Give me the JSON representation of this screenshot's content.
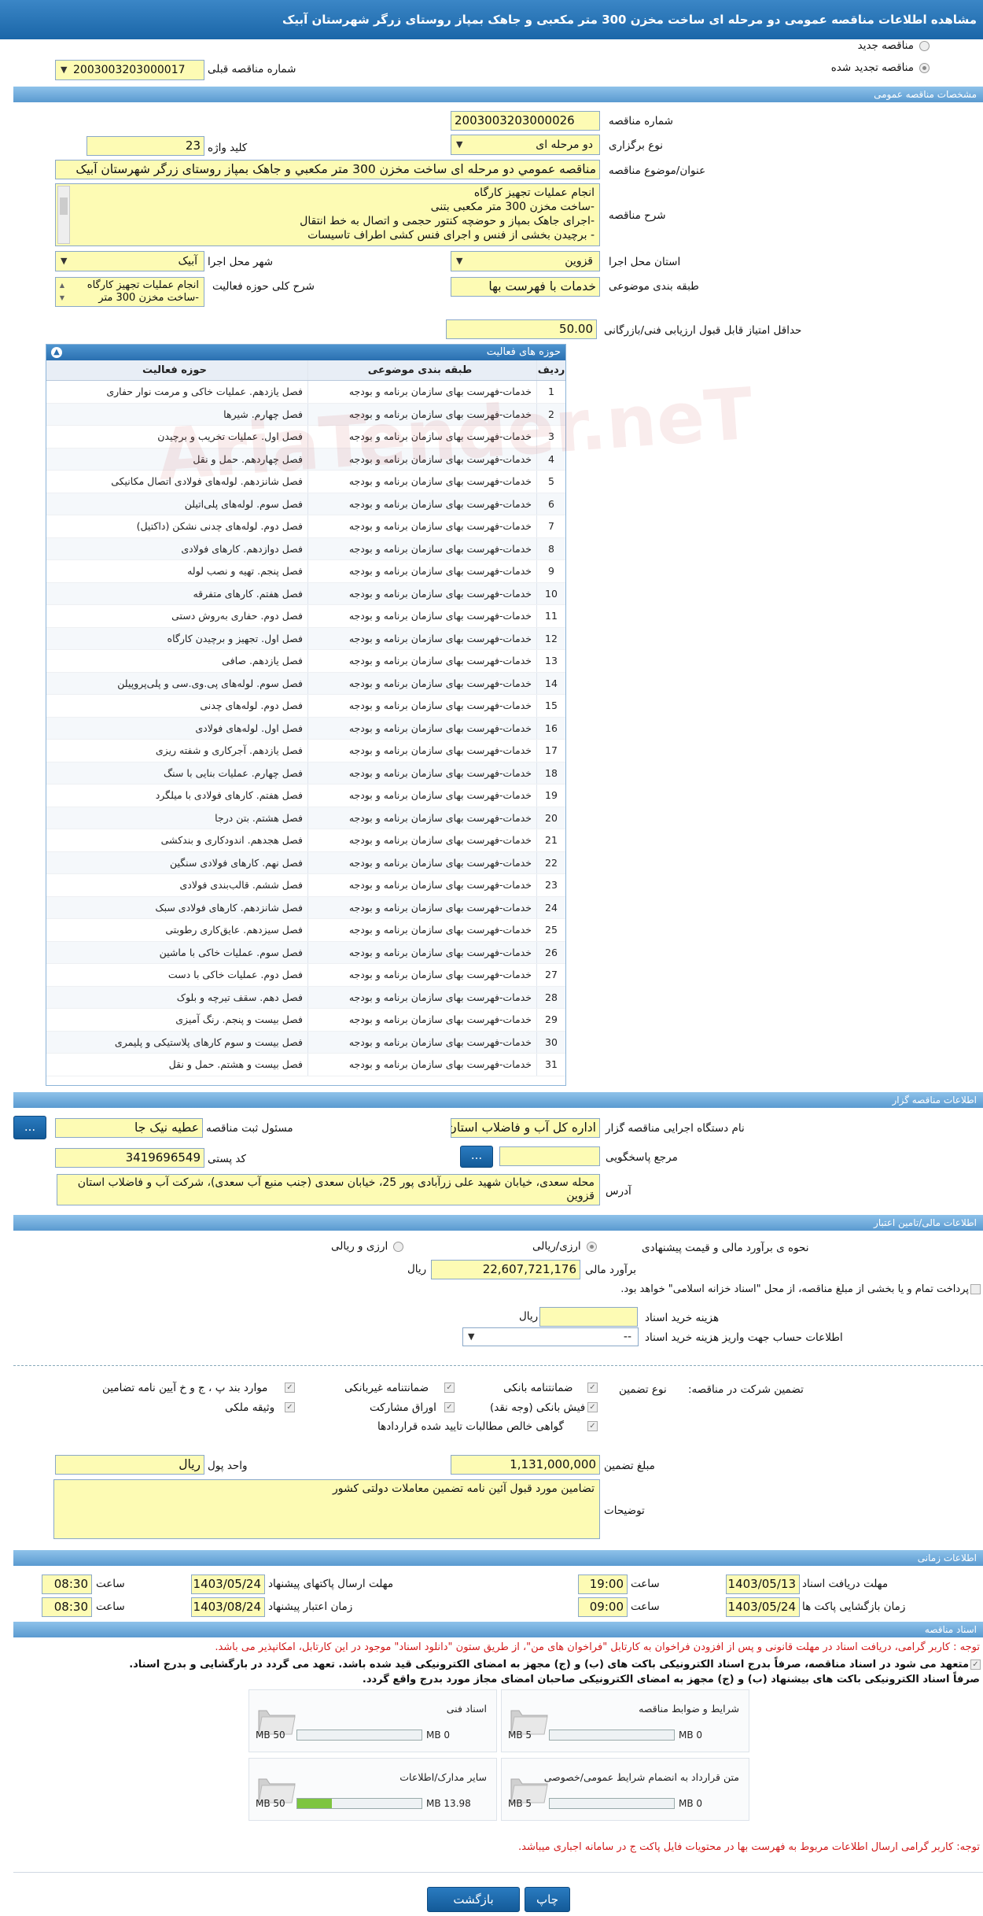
{
  "header": {
    "title": "مشاهده اطلاعات مناقصه عمومی دو مرحله ای ساخت مخزن 300 متر مکعبی و جاهک بمپاز روستای زرگر شهرستان آبیک"
  },
  "type": {
    "new": "مناقصه جدید",
    "renewed": "مناقصه تجدید شده",
    "prev_label": "شماره مناقصه قبلی",
    "prev_value": "2003003203000017"
  },
  "general": {
    "section": "مشخصات مناقصه عمومی",
    "number_label": "شماره مناقصه",
    "number": "2003003203000026",
    "holding_label": "نوع برگزاری",
    "holding": "دو مرحله ای",
    "keyword_label": "کلید واژه",
    "keyword": "23",
    "subject_label": "عنوان/موضوع مناقصه",
    "subject": "مناقصه عمومي دو مرحله ای ساخت مخزن 300 متر مکعبي و جاهک  بمپاز روستای زرگر شهرستان آبیک",
    "desc_label": "شرح مناقصه",
    "desc": [
      "انجام عملیات تجهیز کارگاه",
      "-ساخت مخزن 300 متر مکعبی بتنی",
      "-اجرای جاهک بمپاز و حوضچه کنتور حجمی و اتصال به خط انتقال",
      "- برچیدن بخشی از فنس و اجرای فنس کشی اطراف تاسیسات"
    ],
    "province_label": "استان محل اجرا",
    "province": "قزوین",
    "city_label": "شهر محل اجرا",
    "city": "آبیک",
    "category_label": "طبقه بندی موضوعی",
    "category": "خدمات با فهرست بها",
    "activity_desc_label": "شرح کلی حوزه فعالیت",
    "activity_desc": [
      "انجام عملیات تجهیز کارگاه",
      "-ساخت مخزن 300 متر"
    ],
    "min_score_label": "حداقل امتیاز قابل قبول ارزیابی فنی/بازرگانی",
    "min_score": "50.00"
  },
  "activities": {
    "title": "حوزه های فعالیت",
    "col_row": "ردیف",
    "col_category": "طبقه بندی موضوعی",
    "col_activity": "حوزه فعالیت",
    "rows": [
      [
        "1",
        "خدمات-فهرست بهای سازمان برنامه و بودجه",
        "فصل یازدهم. عملیات خاکی و مرمت نوار حفاری"
      ],
      [
        "2",
        "خدمات-فهرست بهای سازمان برنامه و بودجه",
        "فصل چهارم. شیرها"
      ],
      [
        "3",
        "خدمات-فهرست بهای سازمان برنامه و بودجه",
        "فصل اول. عملیات تخریب و برچیدن"
      ],
      [
        "4",
        "خدمات-فهرست بهای سازمان برنامه و بودجه",
        "فصل چهاردهم. حمل و نقل"
      ],
      [
        "5",
        "خدمات-فهرست بهای سازمان برنامه و بودجه",
        "فصل شانزدهم. لوله‌های فولادی اتصال مکانیکی"
      ],
      [
        "6",
        "خدمات-فهرست بهای سازمان برنامه و بودجه",
        "فصل سوم. لوله‌های پلی‌اتیلن"
      ],
      [
        "7",
        "خدمات-فهرست بهای سازمان برنامه و بودجه",
        "فصل دوم. لوله‌های چدنی نشکن (داکتیل)"
      ],
      [
        "8",
        "خدمات-فهرست بهای سازمان برنامه و بودجه",
        "فصل دوازدهم. کارهای فولادی"
      ],
      [
        "9",
        "خدمات-فهرست بهای سازمان برنامه و بودجه",
        "فصل پنجم. تهیه و نصب لوله"
      ],
      [
        "10",
        "خدمات-فهرست بهای سازمان برنامه و بودجه",
        "فصل هفتم. کارهای متفرقه"
      ],
      [
        "11",
        "خدمات-فهرست بهای سازمان برنامه و بودجه",
        "فصل دوم. حفاری به‌روش دستی"
      ],
      [
        "12",
        "خدمات-فهرست بهای سازمان برنامه و بودجه",
        "فصل اول. تجهیز و برچیدن کارگاه"
      ],
      [
        "13",
        "خدمات-فهرست بهای سازمان برنامه و بودجه",
        "فصل یازدهم. صافی"
      ],
      [
        "14",
        "خدمات-فهرست بهای سازمان برنامه و بودجه",
        "فصل سوم. لوله‌های پی.وی.سی و پلی‌پروپیلن"
      ],
      [
        "15",
        "خدمات-فهرست بهای سازمان برنامه و بودجه",
        "فصل دوم. لوله‌های چدنی"
      ],
      [
        "16",
        "خدمات-فهرست بهای سازمان برنامه و بودجه",
        "فصل اول. لوله‌های فولادی"
      ],
      [
        "17",
        "خدمات-فهرست بهای سازمان برنامه و بودجه",
        "فصل یازدهم. آجرکاری و شفته ریزی"
      ],
      [
        "18",
        "خدمات-فهرست بهای سازمان برنامه و بودجه",
        "فصل چهارم. عملیات بنایی با سنگ"
      ],
      [
        "19",
        "خدمات-فهرست بهای سازمان برنامه و بودجه",
        "فصل هفتم. کارهای فولادی با میلگرد"
      ],
      [
        "20",
        "خدمات-فهرست بهای سازمان برنامه و بودجه",
        "فصل هشتم. بتن درجا"
      ],
      [
        "21",
        "خدمات-فهرست بهای سازمان برنامه و بودجه",
        "فصل هجدهم. اندودکاری و بندکشی"
      ],
      [
        "22",
        "خدمات-فهرست بهای سازمان برنامه و بودجه",
        "فصل نهم. کارهای فولادی سنگین"
      ],
      [
        "23",
        "خدمات-فهرست بهای سازمان برنامه و بودجه",
        "فصل ششم. قالب‌بندی فولادی"
      ],
      [
        "24",
        "خدمات-فهرست بهای سازمان برنامه و بودجه",
        "فصل شانزدهم. کارهای فولادی سبک"
      ],
      [
        "25",
        "خدمات-فهرست بهای سازمان برنامه و بودجه",
        "فصل سیزدهم. عایق‌کاری رطوبتی"
      ],
      [
        "26",
        "خدمات-فهرست بهای سازمان برنامه و بودجه",
        "فصل سوم. عملیات خاکی با ماشین"
      ],
      [
        "27",
        "خدمات-فهرست بهای سازمان برنامه و بودجه",
        "فصل دوم. عملیات خاکی با دست"
      ],
      [
        "28",
        "خدمات-فهرست بهای سازمان برنامه و بودجه",
        "فصل دهم. سقف تیرچه و بلوک"
      ],
      [
        "29",
        "خدمات-فهرست بهای سازمان برنامه و بودجه",
        "فصل بیست و پنجم. رنگ آمیزی"
      ],
      [
        "30",
        "خدمات-فهرست بهای سازمان برنامه و بودجه",
        "فصل بیست و سوم کارهای پلاستیکی و پلیمری"
      ],
      [
        "31",
        "خدمات-فهرست بهای سازمان برنامه و بودجه",
        "فصل بیست و هشتم. حمل و نقل"
      ]
    ]
  },
  "watermark": "AriaTender.neT",
  "organizer": {
    "section": "اطلاعات مناقصه گزار",
    "org_label": "نام دستگاه اجرایی مناقصه گزار",
    "org": "اداره کل آب و فاضلاب استان قزوین",
    "resp_label": "مسئول ثبت مناقصه",
    "resp": "عطیه نیک جا",
    "ref_label": "مرجع پاسخگویی",
    "ref": "",
    "postal_label": "کد پستی",
    "postal": "3419696549",
    "address_label": "آدرس",
    "address": "محله سعدی، خیابان شهید علی زرآبادی پور 25، خیابان سعدی (جنب منبع آب سعدی)، شرکت آب و فاضلاب استان قزوین",
    "more_btn": "..."
  },
  "finance": {
    "section": "اطلاعات مالی/تامین اعتبار",
    "estimate_type_label": "نحوه ی برآورد مالی و قیمت پیشنهادی",
    "opt1": "ارزی/ریالی",
    "opt2": "ارزی و ریالی",
    "estimate_label": "برآورد مالی",
    "estimate": "22,607,721,176",
    "rial": "ریال",
    "islamic_note": "پرداخت تمام و یا بخشی از مبلغ مناقصه، از محل \"اسناد خزانه اسلامی\" خواهد بود.",
    "doc_fee_label": "هزینه خرید اسناد",
    "doc_fee": "",
    "doc_fee_unit": "ریال",
    "account_label": "اطلاعات حساب جهت واریز هزینه خرید اسناد",
    "account": "--"
  },
  "guarantee": {
    "type_label": "نوع تضمین",
    "participate_label": "تضمین شرکت در مناقصه:",
    "items": [
      "ضمانتنامه بانکی",
      "ضمانتنامه غیربانکی",
      "موارد بند پ ، ج و خ آیین نامه تضامین",
      "فیش بانکی (وجه نقد)",
      "اوراق مشارکت",
      "وثیقه ملکی",
      "گواهی خالص مطالبات تایید شده قراردادها"
    ],
    "amount_label": "مبلغ تضمین",
    "amount": "1,131,000,000",
    "currency_label": "واحد پول",
    "currency": "ریال",
    "notes_label": "توضیحات",
    "notes": "تضامین مورد قبول آئین نامه تضمین معاملات دولتی کشور"
  },
  "timing": {
    "section": "اطلاعات زمانی",
    "doc_receive_label": "مهلت دریافت اسناد",
    "doc_receive": "1403/05/13",
    "time_label": "ساعت",
    "doc_receive_time": "19:00",
    "send_label": "مهلت ارسال پاکتهای پیشنهاد",
    "send": "1403/05/24",
    "send_time": "08:30",
    "open_label": "زمان بازگشایی پاکت ها",
    "open": "1403/05/24",
    "open_time": "09:00",
    "valid_label": "زمان اعتبار پیشنهاد",
    "valid": "1403/08/24",
    "valid_time": "08:30"
  },
  "docs": {
    "section": "اسناد مناقصه",
    "note1": "توجه : کاربر گرامی، دریافت اسناد در مهلت قانونی و پس از افزودن فراخوان به کارتابل \"فراخوان های من\"، از طریق ستون \"دانلود اسناد\" موجود در این کارتابل، امکانپذیر می باشد.",
    "note2": "متعهد می شود در اسناد مناقصه، صرفاً بدرج اسناد الکترونیکی باکت های (ب) و (ج) مجهز به امضای الکترونیکی قید شده باشد. تعهد می گردد در بارگشایی و بدرج اسناد.",
    "note3": "صرفاً اسناد الکترونیکی باکت های بیشنهاد (ب) و (ج) مجهز به امضای الکترونیکی صاحبان امضای مجاز مورد بدرج واقع گردد.",
    "files": [
      {
        "name": "شرایط و ضوابط مناقصه",
        "current": "0 MB",
        "max": "5 MB",
        "fill": 0
      },
      {
        "name": "اسناد فنی",
        "current": "0 MB",
        "max": "50 MB",
        "fill": 0
      },
      {
        "name": "متن قرارداد به انضمام شرایط عمومی/خصوصی",
        "current": "0 MB",
        "max": "5 MB",
        "fill": 0
      },
      {
        "name": "سایر مدارک/اطلاعات",
        "current": "13.98 MB",
        "max": "50 MB",
        "fill": 0.28
      }
    ],
    "bottom_note": "توجه: کاربر گرامی ارسال اطلاعات مربوط به فهرست بها در محتویات فایل پاکت ج در سامانه اجباری میباشد."
  },
  "footer": {
    "print": "چاپ",
    "back": "بازگشت"
  },
  "colors": {
    "header": "#1a66a8",
    "field": "#fdfbb4",
    "section": "#6aa6d8",
    "alert": "#d01818"
  }
}
